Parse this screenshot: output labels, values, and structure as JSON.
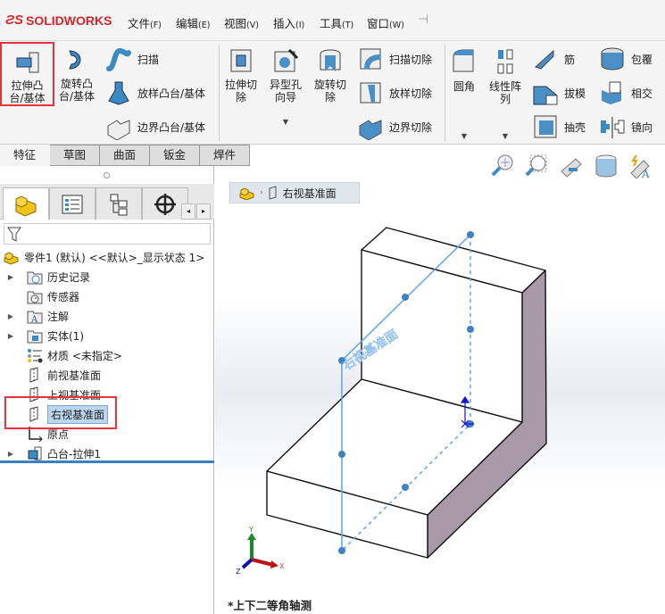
{
  "app": {
    "logo": "SOLIDWORKS"
  },
  "menu": [
    {
      "label": "文件",
      "key": "(F)"
    },
    {
      "label": "编辑",
      "key": "(E)"
    },
    {
      "label": "视图",
      "key": "(V)"
    },
    {
      "label": "插入",
      "key": "(I)"
    },
    {
      "label": "工具",
      "key": "(T)"
    },
    {
      "label": "窗口",
      "key": "(W)"
    }
  ],
  "ribbon": {
    "extrude_boss": "拉伸凸\n台/基体",
    "revolve_boss": "旋转凸\n台/基体",
    "sweep": "扫描",
    "loft_boss": "放样凸台/基体",
    "boundary_boss": "边界凸台/基体",
    "extrude_cut": "拉伸切\n除",
    "hole_wizard": "异型孔\n向导",
    "revolve_cut": "旋转切\n除",
    "sweep_cut": "扫描切除",
    "loft_cut": "放样切除",
    "boundary_cut": "边界切除",
    "fillet": "圆角",
    "linear_pattern": "线性阵\n列",
    "rib": "筋",
    "draft": "拔模",
    "shell": "抽壳",
    "wrap": "包覆",
    "intersect": "相交",
    "mirror": "镜向"
  },
  "tabs": [
    "特征",
    "草图",
    "曲面",
    "钣金",
    "焊件"
  ],
  "tree": {
    "root": "零件1 (默认) <<默认>_显示状态 1>",
    "items": [
      {
        "label": "历史记录",
        "icon": "history-folder-icon",
        "expandable": true
      },
      {
        "label": "传感器",
        "icon": "sensor-folder-icon",
        "expandable": false
      },
      {
        "label": "注解",
        "icon": "annotation-folder-icon",
        "expandable": true
      },
      {
        "label": "实体(1)",
        "icon": "solid-body-folder-icon",
        "expandable": true
      },
      {
        "label": "材质 <未指定>",
        "icon": "material-icon",
        "expandable": false
      },
      {
        "label": "前视基准面",
        "icon": "plane-icon",
        "expandable": false
      },
      {
        "label": "上视基准面",
        "icon": "plane-icon",
        "expandable": false
      },
      {
        "label": "右视基准面",
        "icon": "plane-icon",
        "expandable": false,
        "selected": true
      },
      {
        "label": "原点",
        "icon": "origin-icon",
        "expandable": false
      },
      {
        "label": "凸台-拉伸1",
        "icon": "extrude-feature-icon",
        "expandable": true
      }
    ]
  },
  "viewport": {
    "breadcrumb": "右视基准面",
    "plane_label": "右视基准面",
    "view_name": "*上下二等角轴测",
    "axes": {
      "x": "X",
      "y": "Y",
      "z": "Z"
    }
  },
  "colors": {
    "highlight": "#e8333a",
    "selection": "#bcd6ee",
    "plane": "#5aa6f0",
    "side_face": "#a899a8"
  }
}
